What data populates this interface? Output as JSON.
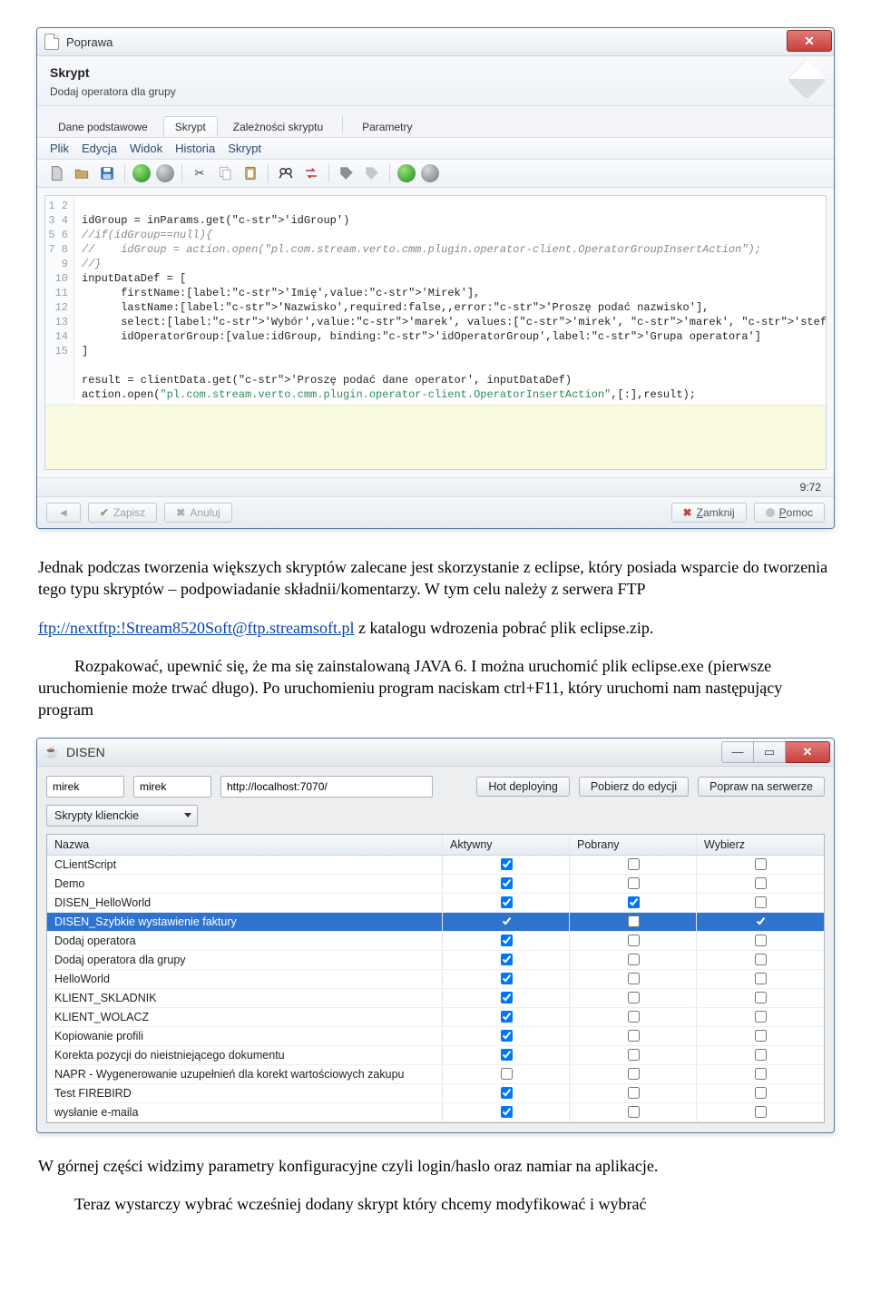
{
  "window1": {
    "title": "Poprawa",
    "heading": "Skrypt",
    "subheading": "Dodaj operatora dla grupy",
    "tabs": [
      {
        "label": "Dane podstawowe",
        "active": false
      },
      {
        "label": "Skrypt",
        "active": true
      },
      {
        "label": "Zależności skryptu",
        "active": false
      },
      {
        "label": "Parametry",
        "active": false
      }
    ],
    "menu": [
      "Plik",
      "Edycja",
      "Widok",
      "Historia",
      "Skrypt"
    ],
    "code_lines": [
      "",
      "idGroup = inParams.get('idGroup')",
      "//if(idGroup==null){",
      "//    idGroup = action.open(\"pl.com.stream.verto.cmm.plugin.operator-client.OperatorGroupInsertAction\");",
      "//}",
      "inputDataDef = [",
      "      firstName:[label:'Imię',value:'Mirek'],",
      "      lastName:[label:'Nazwisko',required:false,,error:'Proszę podać nazwisko'],",
      "      select:[label:'Wybór',value:'marek', values:['mirek', 'marek', 'stefan']],",
      "      idOperatorGroup:[value:idGroup, binding:'idOperatorGroup',label:'Grupa operatora']",
      "]",
      "",
      "result = clientData.get('Proszę podać dane operator', inputDataDef)",
      "action.open(\"pl.com.stream.verto.cmm.plugin.operator-client.OperatorInsertAction\",[:],result);",
      ""
    ],
    "cursor": "9:72",
    "footer": {
      "save": "Zapisz",
      "cancel": "Anuluj",
      "close": "Zamknij",
      "help": "Pomoc"
    }
  },
  "prose": {
    "p1": "Jednak podczas tworzenia większych skryptów zalecane jest skorzystanie z eclipse, który posiada wsparcie do tworzenia tego typu skryptów – podpowiadanie składnii/komentarzy. W tym celu należy z serwera FTP",
    "link_text": "ftp://nextftp:!Stream8520Soft@ftp.streamsoft.pl",
    "p2_tail": " z katalogu wdrozenia pobrać plik eclipse.zip.",
    "p3": "Rozpakować, upewnić się, że ma się zainstalowaną JAVA 6. I można uruchomić plik eclipse.exe (pierwsze uruchomienie może trwać długo). Po uruchomieniu program naciskam ctrl+F11, który uruchomi nam następujący program",
    "p4": "W górnej części widzimy parametry konfiguracyjne czyli login/haslo oraz namiar na aplikacje.",
    "p5": "Teraz wystarczy wybrać wcześniej dodany skrypt który chcemy modyfikować i wybrać"
  },
  "window2": {
    "title": "DISEN",
    "inputs": {
      "user": "mirek",
      "pass": "mirek",
      "url": "http://localhost:7070/"
    },
    "buttons": {
      "hot": "Hot deploying",
      "fetch": "Pobierz do edycji",
      "edit": "Popraw na serwerze"
    },
    "combo": "Skrypty klienckie",
    "columns": [
      "Nazwa",
      "Aktywny",
      "Pobrany",
      "Wybierz"
    ],
    "rows": [
      {
        "name": "CLientScript",
        "active": true,
        "fetched": false,
        "select": false,
        "selected": false
      },
      {
        "name": "Demo",
        "active": true,
        "fetched": false,
        "select": false,
        "selected": false
      },
      {
        "name": "DISEN_HelloWorld",
        "active": true,
        "fetched": true,
        "select": false,
        "selected": false
      },
      {
        "name": "DISEN_Szybkie wystawienie faktury",
        "active": true,
        "fetched": false,
        "select": true,
        "selected": true
      },
      {
        "name": "Dodaj operatora",
        "active": true,
        "fetched": false,
        "select": false,
        "selected": false
      },
      {
        "name": "Dodaj operatora dla grupy",
        "active": true,
        "fetched": false,
        "select": false,
        "selected": false
      },
      {
        "name": "HelloWorld",
        "active": true,
        "fetched": false,
        "select": false,
        "selected": false
      },
      {
        "name": "KLIENT_SKLADNIK",
        "active": true,
        "fetched": false,
        "select": false,
        "selected": false
      },
      {
        "name": "KLIENT_WOLACZ",
        "active": true,
        "fetched": false,
        "select": false,
        "selected": false
      },
      {
        "name": "Kopiowanie profili",
        "active": true,
        "fetched": false,
        "select": false,
        "selected": false
      },
      {
        "name": "Korekta pozycji do nieistniejącego dokumentu",
        "active": true,
        "fetched": false,
        "select": false,
        "selected": false
      },
      {
        "name": "NAPR - Wygenerowanie uzupełnień dla korekt wartościowych zakupu",
        "active": false,
        "fetched": false,
        "select": false,
        "selected": false
      },
      {
        "name": "Test FIREBIRD",
        "active": true,
        "fetched": false,
        "select": false,
        "selected": false
      },
      {
        "name": "wysłanie e-maila",
        "active": true,
        "fetched": false,
        "select": false,
        "selected": false
      }
    ]
  }
}
